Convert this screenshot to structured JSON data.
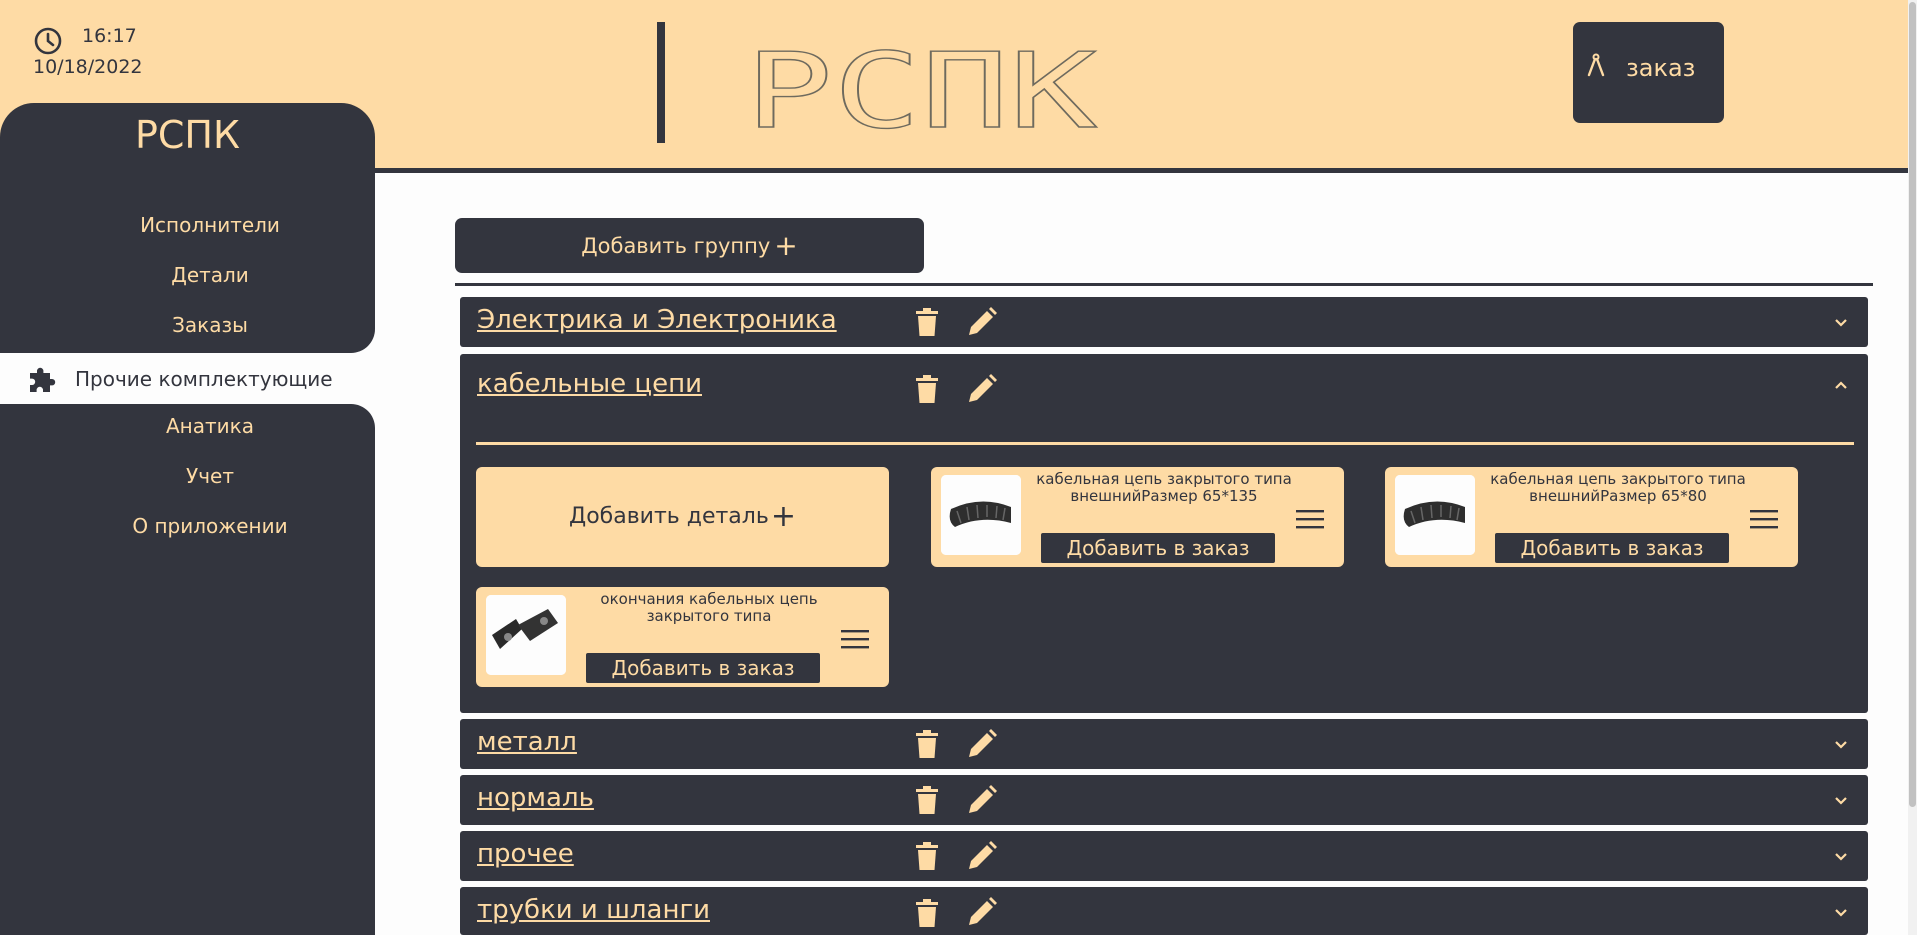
{
  "header": {
    "time": "16:17",
    "date": "10/18/2022",
    "clock_icon": "clock-icon",
    "logo_text": "РСПК",
    "order_button": {
      "label": "заказ",
      "icon": "compass-icon"
    }
  },
  "sidebar": {
    "brand": "РСПК",
    "items": [
      {
        "label": "Исполнители"
      },
      {
        "label": "Детали"
      },
      {
        "label": "Заказы"
      },
      {
        "label": "Прочие комплектующие",
        "active": true,
        "icon": "puzzle-icon"
      },
      {
        "label": "Анатика"
      },
      {
        "label": "Учет"
      },
      {
        "label": "О приложении"
      }
    ]
  },
  "main": {
    "add_group_label": "Добавить группу",
    "groups": [
      {
        "title": "Электрика и Электроника",
        "expanded": false
      },
      {
        "title": "кабельные цепи",
        "expanded": true
      },
      {
        "title": "металл",
        "expanded": false
      },
      {
        "title": "нормаль",
        "expanded": false
      },
      {
        "title": "прочее",
        "expanded": false
      },
      {
        "title": "трубки и шланги",
        "expanded": false
      }
    ],
    "add_detail_label": "Добавить деталь",
    "cards": [
      {
        "name": "кабельная цепь закрытого типа внешнийРазмер 65*135",
        "button": "Добавить в заказ",
        "image": "cable-chain-image"
      },
      {
        "name": "кабельная цепь закрытого типа внешнийРазмер 65*80",
        "button": "Добавить в заказ",
        "image": "cable-chain-image"
      },
      {
        "name": "окончания кабельных цепь закрытого типа",
        "button": "Добавить в заказ",
        "image": "chain-end-image"
      }
    ]
  },
  "colors": {
    "accent": "#fedba5",
    "dark": "#33353e",
    "background": "#fdfdfd"
  }
}
